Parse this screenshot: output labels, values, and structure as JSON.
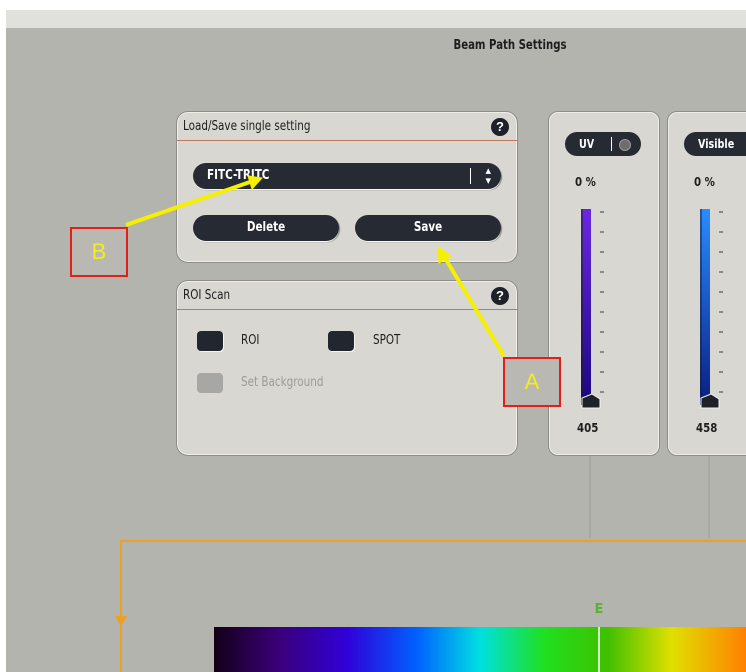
{
  "window": {
    "title": "Beam Path Settings"
  },
  "load_save_panel": {
    "title": "Load/Save single setting",
    "help_icon": "?",
    "selected_setting": "FITC-TRITC",
    "delete_label": "Delete",
    "save_label": "Save"
  },
  "roi_panel": {
    "title": "ROI Scan",
    "help_icon": "?",
    "roi_label": "ROI",
    "spot_label": "SPOT",
    "background_label": "Set Background"
  },
  "lasers": [
    {
      "name": "UV",
      "percent": "0 %",
      "wavelength": "405",
      "color": "#5b1fd0",
      "level": 0
    },
    {
      "name": "Visible",
      "percent": "0 %",
      "wavelength": "458",
      "color": "#1f6fe0",
      "level": 0
    }
  ],
  "spectrum_marker": "E",
  "annotations": {
    "a": "A",
    "b": "B"
  },
  "colors": {
    "background": "#b4b4ae",
    "panel": "#d8d7d1",
    "accent_line": "#c0785a",
    "beam_path": "#f0a020",
    "annotation": "#f2ec20",
    "annotation_border": "#e0201a"
  }
}
